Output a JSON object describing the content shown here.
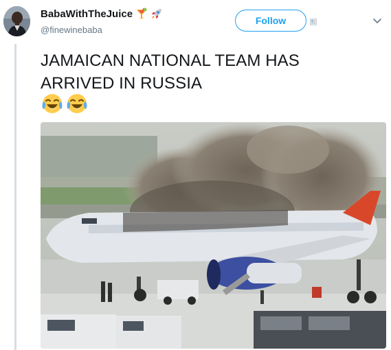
{
  "tweet": {
    "display_name": "BabaWithTheJuice",
    "handle": "@finewinebaba",
    "follow_label": "Follow",
    "text": "JAMAICAN NATIONAL TEAM HAS ARRIVED IN RUSSIA",
    "name_emojis": [
      "tropical-drink-emoji",
      "rocket-emoji"
    ],
    "text_emojis": [
      "tears-of-joy-emoji",
      "tears-of-joy-emoji"
    ]
  },
  "colors": {
    "accent": "#1da1f2",
    "text": "#14171a",
    "secondary_text": "#657786",
    "thread_line": "#d5dde4"
  },
  "media": {
    "icon": "burning-airplane-photo"
  }
}
